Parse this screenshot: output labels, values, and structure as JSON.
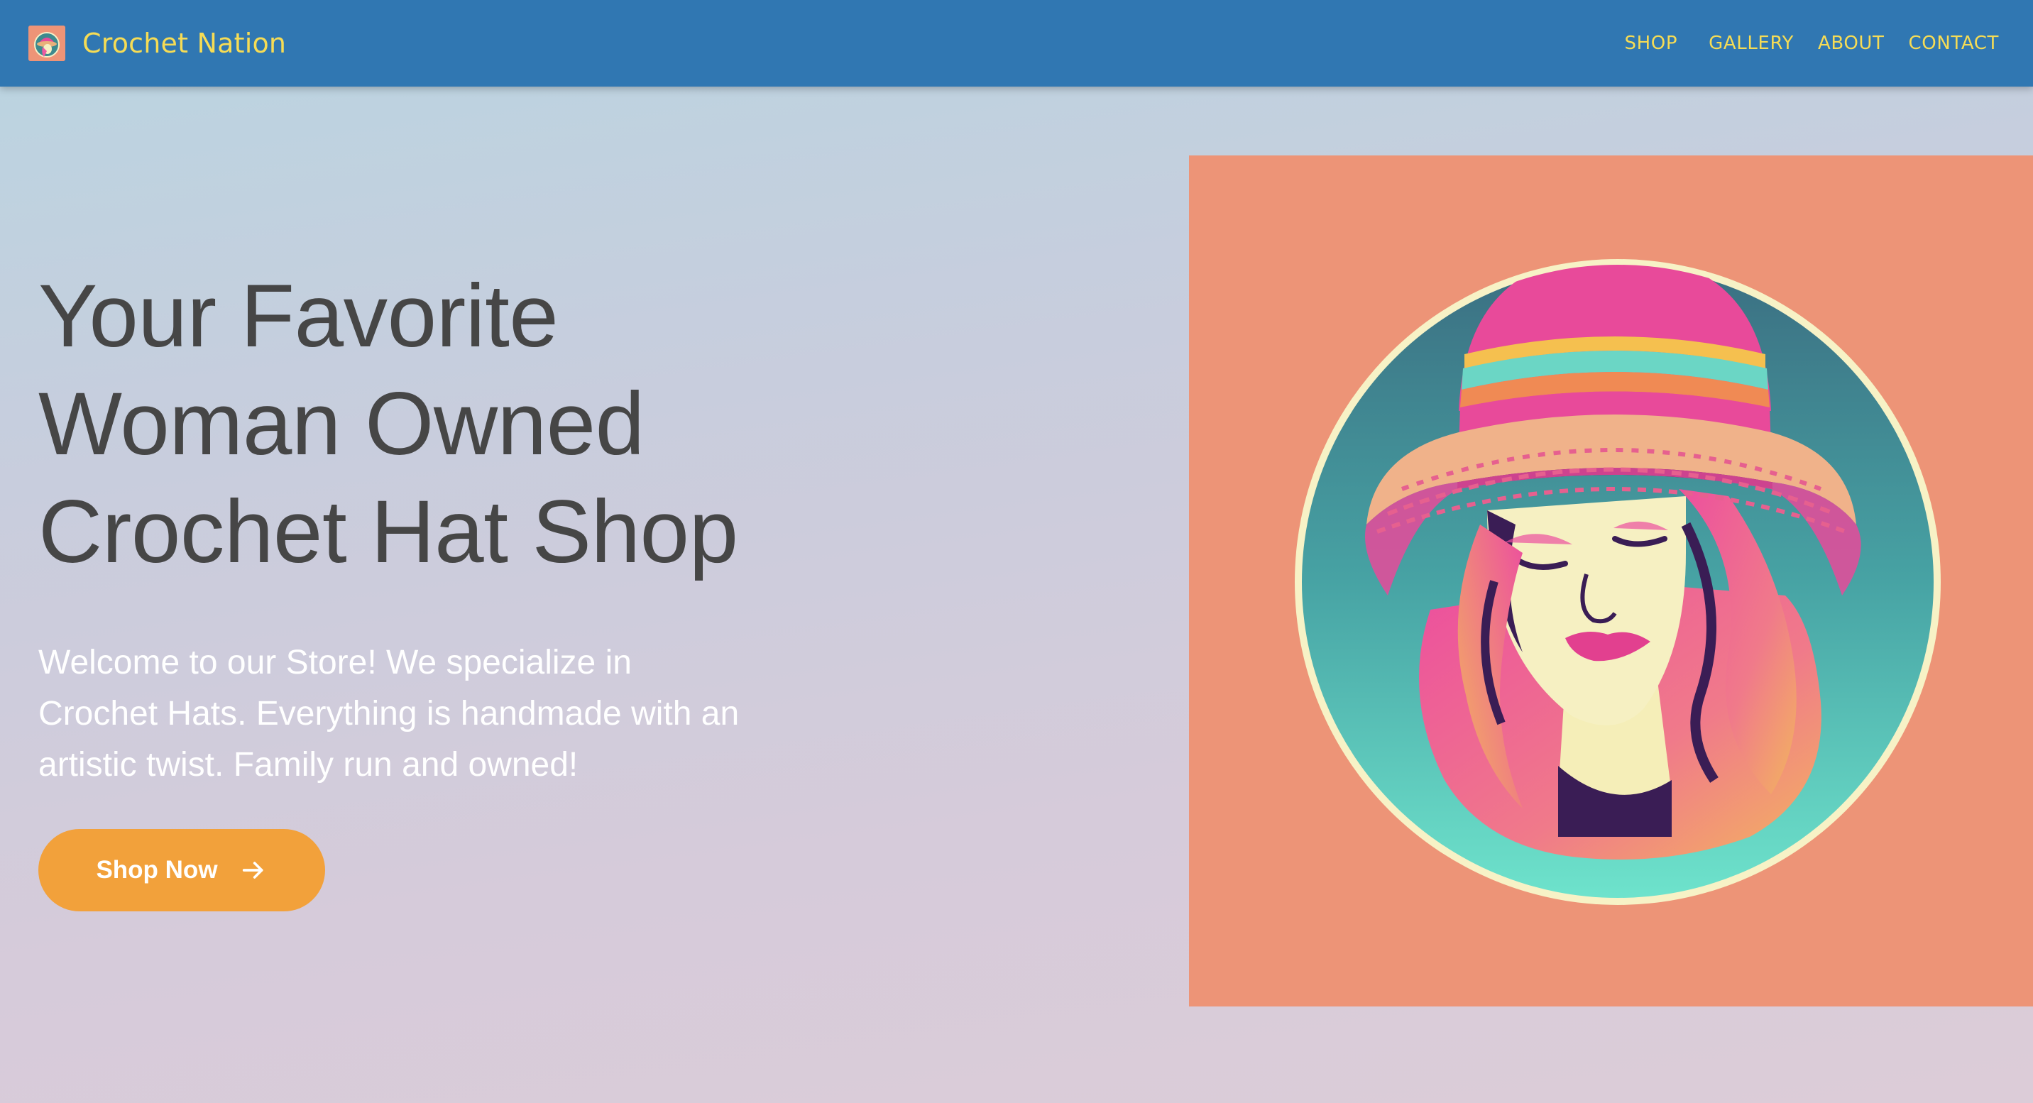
{
  "brand": {
    "name": "Crochet Nation",
    "logo_icon": "woman-in-hat-logo-icon"
  },
  "nav": {
    "items": [
      "SHOP",
      "GALLERY",
      "ABOUT",
      "CONTACT"
    ]
  },
  "hero": {
    "title_lines": [
      "Your Favorite",
      "Woman Owned",
      "Crochet Hat Shop"
    ],
    "description": "Welcome to our Store! We specialize in Crochet Hats. Everything is handmade with an artistic twist. Family run and owned!",
    "cta_label": "Shop Now",
    "cta_icon": "arrow-right-icon",
    "image_subject": "woman-in-crochet-hat-illustration"
  },
  "colors": {
    "navbar": "#3077b2",
    "brand_text": "#f6dc55",
    "title_text": "#464646",
    "cta": "#f2a13b",
    "image_bg": "#ed9477"
  }
}
